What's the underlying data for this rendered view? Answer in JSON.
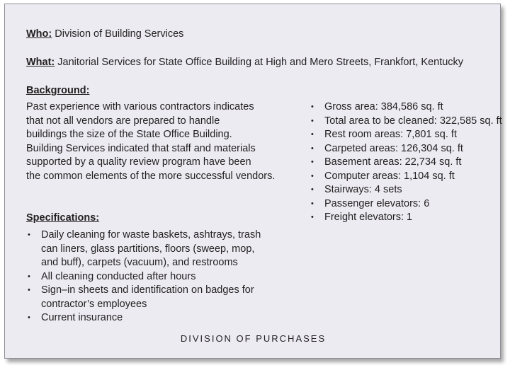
{
  "who": {
    "label": "Who:",
    "value": "Division of Building Services"
  },
  "what": {
    "label": "What:",
    "value": "Janitorial Services for State Office Building at High and Mero Streets, Frankfort, Kentucky"
  },
  "background": {
    "heading": "Background:",
    "lines": [
      "Past experience with various contractors indicates",
      "that not all vendors are prepared to handle",
      "buildings the size of the State Office Building.",
      "Building Services indicated that staff and materials",
      "supported by a quality review program have been",
      "the common elements of the more successful vendors."
    ]
  },
  "facts": [
    "Gross area: 384,586 sq. ft",
    "Total area to be cleaned: 322,585 sq. ft",
    "Rest room areas: 7,801 sq. ft",
    "Carpeted areas: 126,304 sq. ft",
    "Basement areas: 22,734 sq. ft",
    "Computer areas: 1,104 sq. ft",
    "Stairways: 4 sets",
    "Passenger elevators: 6",
    "Freight elevators: 1"
  ],
  "specifications": {
    "heading": "Specifications:",
    "items": [
      [
        "Daily cleaning for waste baskets, ashtrays, trash",
        "can liners, glass partitions, floors (sweep, mop,",
        "and buff), carpets (vacuum), and restrooms"
      ],
      [
        "All cleaning conducted after hours"
      ],
      [
        "Sign–in sheets and identification on badges for",
        "contractor’s employees"
      ],
      [
        "Current insurance"
      ]
    ]
  },
  "footer": "DIVISION OF PURCHASES"
}
